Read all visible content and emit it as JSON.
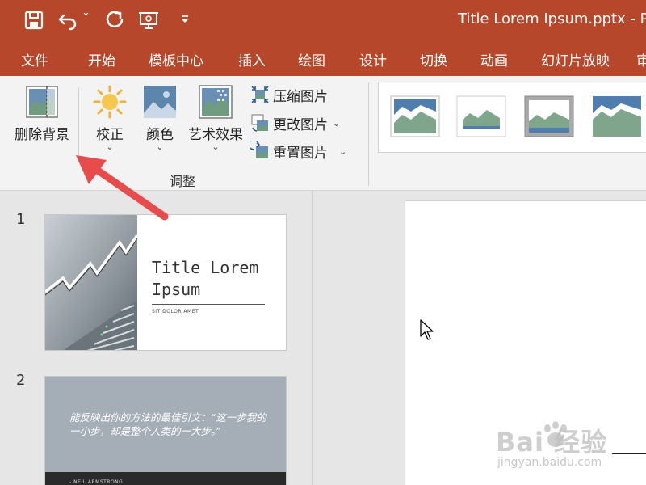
{
  "window": {
    "title": "Title Lorem Ipsum.pptx  -  P"
  },
  "quick_access": {
    "icons": [
      "save-icon",
      "undo-icon",
      "redo-icon",
      "present-icon",
      "customize-icon"
    ],
    "undo_dropdown_glyph": "⌄"
  },
  "menu": {
    "tabs": [
      "文件",
      "开始",
      "模板中心",
      "插入",
      "绘图",
      "设计",
      "切换",
      "动画",
      "幻灯片放映",
      "审"
    ]
  },
  "ribbon": {
    "remove_background": "删除背景",
    "corrections": "校正",
    "color": "颜色",
    "artistic_effects": "艺术效果",
    "compress_pictures": "压缩图片",
    "change_picture": "更改图片",
    "reset_picture": "重置图片",
    "group_label": "调整",
    "chevron": "⌄"
  },
  "slides": {
    "numbers": [
      "1",
      "2"
    ],
    "slide1": {
      "title": "Title Lorem Ipsum",
      "subtitle": "SIT DOLOR AMET"
    },
    "slide2": {
      "quote": "能反映出你的方法的最佳引文：“这一步我的一小步，却是整个人类的一大步。”",
      "author": "- NEIL ARMSTRONG"
    }
  },
  "watermark": {
    "brand": "Bai 经验",
    "url": "jingyan.baidu.com"
  },
  "colors": {
    "accent": "#b7472a",
    "arrow": "#e84b4b",
    "ribbon_bg": "#f3f3f3",
    "pane_bg": "#e6e6e6"
  }
}
